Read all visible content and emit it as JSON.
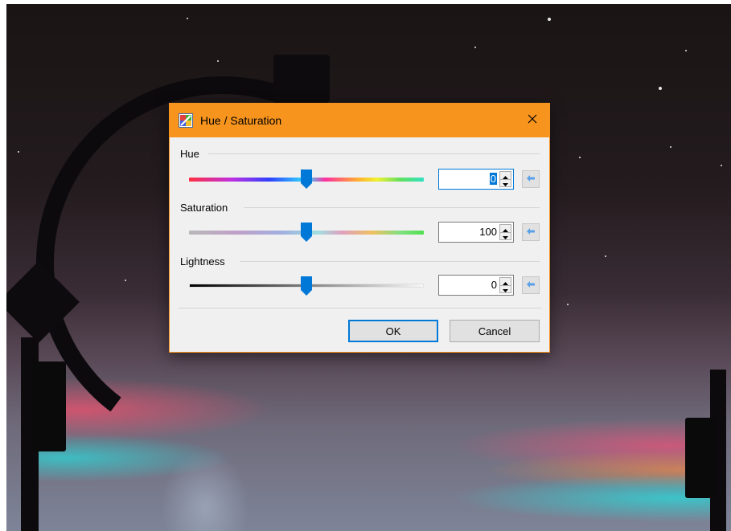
{
  "dialog": {
    "title": "Hue / Saturation",
    "accent_color": "#f7941d",
    "icon": "hue-saturation-app-icon",
    "close_icon": "close-icon"
  },
  "hue": {
    "label": "Hue",
    "value": "0",
    "slider_position": 0.5
  },
  "saturation": {
    "label": "Saturation",
    "value": "100",
    "slider_position": 0.5
  },
  "lightness": {
    "label": "Lightness",
    "value": "0",
    "slider_position": 0.5
  },
  "buttons": {
    "ok": "OK",
    "cancel": "Cancel"
  },
  "icons": {
    "spin_up": "spin-up-arrow-icon",
    "spin_down": "spin-down-arrow-icon",
    "reset": "reset-arrow-icon"
  }
}
